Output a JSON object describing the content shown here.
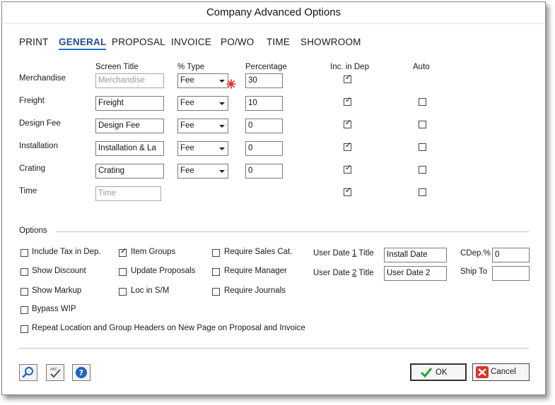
{
  "window": {
    "title": "Company Advanced Options"
  },
  "tabs": [
    {
      "label": "PRINT",
      "active": false
    },
    {
      "label": "GENERAL",
      "active": true
    },
    {
      "label": "PROPOSAL",
      "active": false
    },
    {
      "label": "INVOICE",
      "active": false
    },
    {
      "label": "PO/WO",
      "active": false
    },
    {
      "label": "TIME",
      "active": false
    },
    {
      "label": "SHOWROOM",
      "active": false
    }
  ],
  "columns": {
    "screen_title": "Screen Title",
    "pct_type": "% Type",
    "percentage": "Percentage",
    "inc_in_dep": "Inc. in Dep",
    "auto": "Auto"
  },
  "rows": [
    {
      "label": "Merchandise",
      "screen_title": "Merchandise",
      "type": "Fee",
      "percentage": "30",
      "inc_in_dep": true,
      "auto": null,
      "title_disabled": true
    },
    {
      "label": "Freight",
      "screen_title": "Freight",
      "type": "Fee",
      "percentage": "10",
      "inc_in_dep": true,
      "auto": false
    },
    {
      "label": "Design Fee",
      "screen_title": "Design Fee",
      "type": "Fee",
      "percentage": "0",
      "inc_in_dep": true,
      "auto": false
    },
    {
      "label": "Installation",
      "screen_title": "Installation & La",
      "type": "Fee",
      "percentage": "0",
      "inc_in_dep": true,
      "auto": false
    },
    {
      "label": "Crating",
      "screen_title": "Crating",
      "type": "Fee",
      "percentage": "0",
      "inc_in_dep": true,
      "auto": false
    },
    {
      "label": "Time",
      "screen_title": "Time",
      "type": null,
      "percentage": null,
      "inc_in_dep": true,
      "auto": false,
      "title_disabled": true
    }
  ],
  "options": {
    "heading": "Options",
    "include_tax": {
      "label": "Include Tax in Dep.",
      "checked": false
    },
    "show_discount": {
      "label": "Show Discount",
      "checked": false
    },
    "show_markup": {
      "label": "Show Markup",
      "checked": false
    },
    "bypass_wip": {
      "label": "Bypass WIP",
      "checked": false
    },
    "item_groups": {
      "label": "Item Groups",
      "checked": true
    },
    "update_proposals": {
      "label": "Update Proposals",
      "checked": false
    },
    "loc_in_sm": {
      "label": "Loc in S/M",
      "checked": false
    },
    "require_sales_cat": {
      "label": "Require Sales Cat.",
      "checked": false
    },
    "require_manager": {
      "label": "Require Manager",
      "checked": false
    },
    "require_journals": {
      "label": "Require Journals",
      "checked": false
    },
    "repeat_headers": {
      "label": "Repeat Location and Group Headers on New Page on Proposal and Invoice",
      "checked": false
    },
    "user_date1": {
      "label_pre": "User Date ",
      "label_num": "1",
      "label_post": " Title",
      "value": "Install Date"
    },
    "user_date2": {
      "label_pre": "User Date ",
      "label_num": "2",
      "label_post": " Title",
      "value": "User Date 2"
    },
    "cdep": {
      "label": "CDep.%",
      "value": "0"
    },
    "ship_to": {
      "label": "Ship To",
      "value": ""
    }
  },
  "footer": {
    "ok": "OK",
    "cancel": "Cancel",
    "icons": [
      "search-icon",
      "spellcheck-icon",
      "help-icon"
    ]
  },
  "colors": {
    "accent": "#1f4e8c",
    "ok_check": "#2e9e3a",
    "cancel_x": "#d9342b",
    "help_blue": "#1d63c4"
  }
}
